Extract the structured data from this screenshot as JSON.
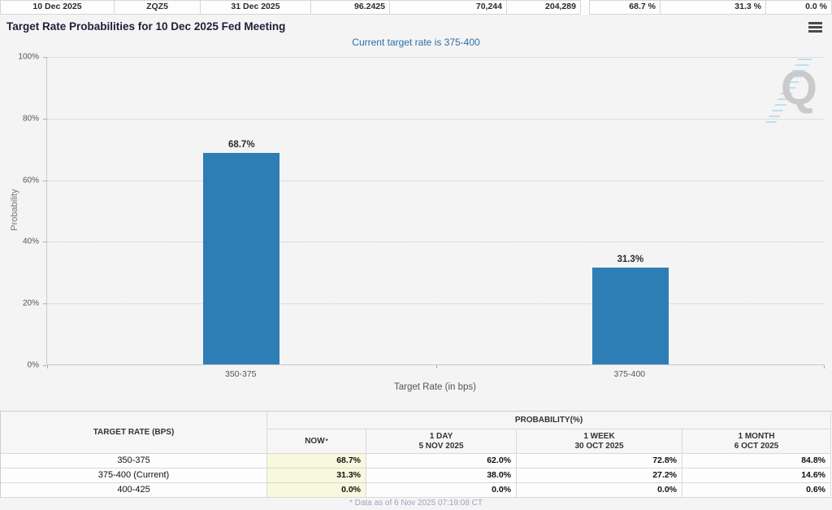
{
  "top_strip": {
    "cells": [
      "10 Dec 2025",
      "ZQZ5",
      "31 Dec 2025",
      "96.2425",
      "70,244",
      "204,289",
      "68.7 %",
      "31.3 %",
      "0.0 %"
    ]
  },
  "header": {
    "title": "Target Rate Probabilities for 10 Dec 2025 Fed Meeting",
    "subtitle": "Current target rate is 375-400"
  },
  "chart_data": {
    "type": "bar",
    "title": "Target Rate Probabilities for 10 Dec 2025 Fed Meeting",
    "subtitle": "Current target rate is 375-400",
    "categories": [
      "350-375",
      "375-400"
    ],
    "values": [
      68.7,
      31.3
    ],
    "value_labels": [
      "68.7%",
      "31.3%"
    ],
    "xlabel": "Target Rate (in bps)",
    "ylabel": "Probability",
    "ylim": [
      0,
      100
    ],
    "yticks": [
      "0%",
      "20%",
      "40%",
      "60%",
      "80%",
      "100%"
    ],
    "grid": "horizontal-dotted",
    "legend": "none",
    "watermark_letter": "Q"
  },
  "table": {
    "col1_header": "TARGET RATE (BPS)",
    "group_header": "PROBABILITY(%)",
    "now_label": "NOW",
    "now_sup": "*",
    "period_headers": [
      [
        "1 DAY",
        "5 NOV 2025"
      ],
      [
        "1 WEEK",
        "30 OCT 2025"
      ],
      [
        "1 MONTH",
        "6 OCT 2025"
      ]
    ],
    "rows": [
      {
        "rate": "350-375",
        "now": "68.7%",
        "day": "62.0%",
        "week": "72.8%",
        "month": "84.8%"
      },
      {
        "rate": "375-400 (Current)",
        "now": "31.3%",
        "day": "38.0%",
        "week": "27.2%",
        "month": "14.6%"
      },
      {
        "rate": "400-425",
        "now": "0.0%",
        "day": "0.0%",
        "week": "0.0%",
        "month": "0.6%"
      }
    ]
  },
  "footer": {
    "note": "* Data as of 6 Nov 2025 07:19:08 CT"
  },
  "colors": {
    "bar": "#2d7eb5",
    "accent_blue": "#2d6da3",
    "now_column_bg": "#f8f8dc",
    "watermark_gray": "#c6c6c6",
    "watermark_blue": "#b7ddef"
  }
}
